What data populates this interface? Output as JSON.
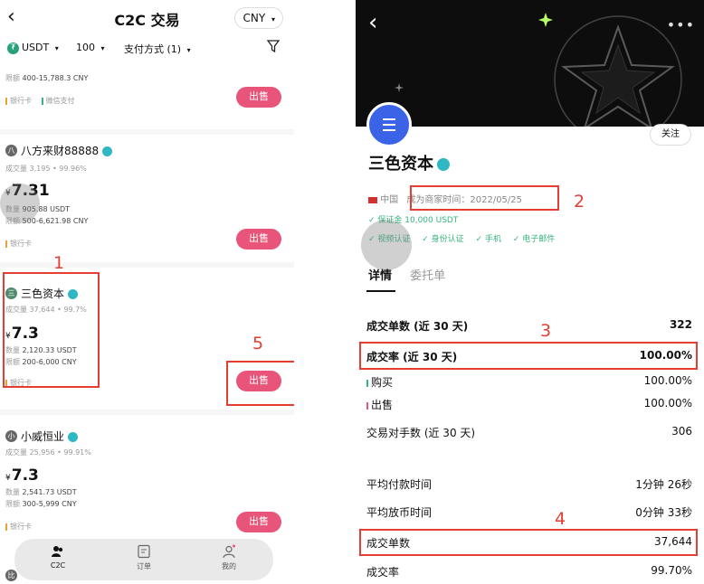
{
  "left": {
    "back": "‹",
    "title": "C2C 交易",
    "currency": "CNY",
    "filters": {
      "coin": "USDT",
      "amount": "100",
      "payment": "支付方式 (1)"
    },
    "top_item": {
      "limit_label": "限额",
      "limit": "400-15,788.3 CNY",
      "pay1": "银行卡",
      "pay2": "微信支付",
      "sell": "出售"
    },
    "merchants": [
      {
        "avatar": "八",
        "name": "八方来财88888",
        "deals_label": "成交量",
        "deals": "3,195",
        "rate": "99.96%",
        "price": "7.31",
        "qty_label": "数量",
        "qty": "905.88 USDT",
        "limit_label": "限额",
        "limit": "500-6,621.98 CNY",
        "pay": "银行卡",
        "sell": "出售"
      },
      {
        "avatar": "三",
        "name": "三色资本",
        "deals_label": "成交量",
        "deals": "37,644",
        "rate": "99.7%",
        "price": "7.3",
        "qty_label": "数量",
        "qty": "2,120.33 USDT",
        "limit_label": "限额",
        "limit": "200-6,000 CNY",
        "pay": "银行卡",
        "sell": "出售"
      },
      {
        "avatar": "小",
        "name": "小威恒业",
        "deals_label": "成交量",
        "deals": "25,956",
        "rate": "99.91%",
        "price": "7.3",
        "qty_label": "数量",
        "qty": "2,541.73 USDT",
        "limit_label": "限额",
        "limit": "300-5,999 CNY",
        "pay": "银行卡",
        "sell": "出售"
      }
    ],
    "yen": "¥",
    "bottom_peek_avatar": "比",
    "tabs": [
      "C2C",
      "订单",
      "我的"
    ]
  },
  "right": {
    "back": "‹",
    "more": "•••",
    "follow": "关注",
    "name": "三色资本",
    "region": "中国",
    "since_label": "成为商家时间：",
    "since": "2022/05/25",
    "deposit": "✓ 保证金 10,000 USDT",
    "verifications": [
      "✓ 视频认证",
      "✓ 身份认证",
      "✓ 手机",
      "✓ 电子邮件"
    ],
    "tab_active": "详情",
    "tab_other": "委托单",
    "stats": [
      {
        "label": "成交单数 (近 30 天)",
        "value": "322",
        "bold": true
      },
      {
        "label": "成交率 (近 30 天)",
        "value": "100.00%",
        "bold": true
      },
      {
        "label": "购买",
        "value": "100.00%",
        "bold": false
      },
      {
        "label": "出售",
        "value": "100.00%",
        "bold": false
      },
      {
        "label": "交易对手数 (近 30 天)",
        "value": "306",
        "bold": false
      },
      {
        "label": "平均付款时间",
        "value": "1分钟 26秒",
        "bold": false
      },
      {
        "label": "平均放币时间",
        "value": "0分钟 33秒",
        "bold": false
      },
      {
        "label": "成交单数",
        "value": "37,644",
        "bold": false
      },
      {
        "label": "成交率",
        "value": "99.70%",
        "bold": false
      }
    ]
  },
  "annotations": [
    "1",
    "2",
    "3",
    "4",
    "5"
  ],
  "colors": {
    "sell": "#e9557a",
    "annotation": "#e43d32",
    "buy_bar": "#36b37e",
    "sell_bar": "#e9557a"
  }
}
